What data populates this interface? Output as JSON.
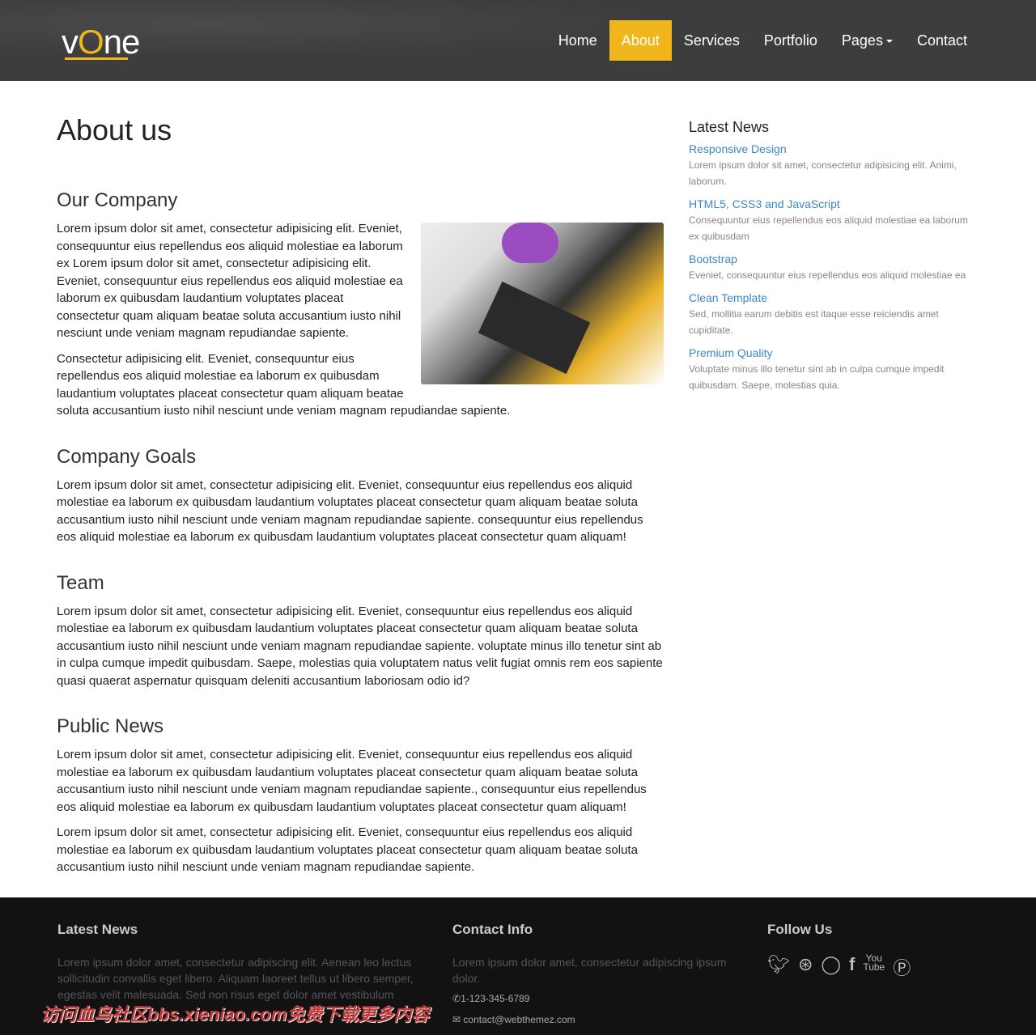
{
  "header": {
    "logo": {
      "v": "v",
      "o": "O",
      "ne": "ne"
    },
    "nav": [
      {
        "label": "Home"
      },
      {
        "label": "About",
        "active": true
      },
      {
        "label": "Services"
      },
      {
        "label": "Portfolio"
      },
      {
        "label": "Pages"
      },
      {
        "label": "Contact"
      }
    ]
  },
  "main": {
    "title": "About us",
    "sections": [
      {
        "heading": "Our Company",
        "paragraphs": [
          "Lorem ipsum dolor sit amet, consectetur adipisicing elit. Eveniet, consequuntur eius repellendus eos aliquid molestiae ea laborum ex Lorem ipsum dolor sit amet, consectetur adipisicing elit. Eveniet, consequuntur eius repellendus eos aliquid molestiae ea laborum ex quibusdam laudantium voluptates placeat consectetur quam aliquam beatae soluta accusantium iusto nihil nesciunt unde veniam magnam repudiandae sapiente.",
          "Consectetur adipisicing elit. Eveniet, consequuntur eius repellendus eos aliquid molestiae ea laborum ex quibusdam laudantium voluptates placeat consectetur quam aliquam beatae soluta accusantium iusto nihil nesciunt unde veniam magnam repudiandae sapiente."
        ]
      },
      {
        "heading": "Company Goals",
        "paragraphs": [
          "Lorem ipsum dolor sit amet, consectetur adipisicing elit. Eveniet, consequuntur eius repellendus eos aliquid molestiae ea laborum ex quibusdam laudantium voluptates placeat consectetur quam aliquam beatae soluta accusantium iusto nihil nesciunt unde veniam magnam repudiandae sapiente. consequuntur eius repellendus eos aliquid molestiae ea laborum ex quibusdam laudantium voluptates placeat consectetur quam aliquam!"
        ]
      },
      {
        "heading": "Team",
        "paragraphs": [
          "Lorem ipsum dolor sit amet, consectetur adipisicing elit. Eveniet, consequuntur eius repellendus eos aliquid molestiae ea laborum ex quibusdam laudantium voluptates placeat consectetur quam aliquam beatae soluta accusantium iusto nihil nesciunt unde veniam magnam repudiandae sapiente. voluptate minus illo tenetur sint ab in culpa cumque impedit quibusdam. Saepe, molestias quia voluptatem natus velit fugiat omnis rem eos sapiente quasi quaerat aspernatur quisquam deleniti accusantium laboriosam odio id?"
        ]
      },
      {
        "heading": "Public News",
        "paragraphs": [
          "Lorem ipsum dolor sit amet, consectetur adipisicing elit. Eveniet, consequuntur eius repellendus eos aliquid molestiae ea laborum ex quibusdam laudantium voluptates placeat consectetur quam aliquam beatae soluta accusantium iusto nihil nesciunt unde veniam magnam repudiandae sapiente., consequuntur eius repellendus eos aliquid molestiae ea laborum ex quibusdam laudantium voluptates placeat consectetur quam aliquam!",
          "Lorem ipsum dolor sit amet, consectetur adipisicing elit. Eveniet, consequuntur eius repellendus eos aliquid molestiae ea laborum ex quibusdam laudantium voluptates placeat consectetur quam aliquam beatae soluta accusantium iusto nihil nesciunt unde veniam magnam repudiandae sapiente."
        ]
      }
    ]
  },
  "sidebar": {
    "title": "Latest News",
    "items": [
      {
        "title": "Responsive Design",
        "text": "Lorem ipsum dolor sit amet, consectetur adipisicing elit. Animi, laborum."
      },
      {
        "title": "HTML5, CSS3 and JavaScript",
        "text": "Consequuntur eius repellendus eos aliquid molestiae ea laborum ex quibusdam"
      },
      {
        "title": "Bootstrap",
        "text": "Eveniet, consequuntur eius repellendus eos aliquid molestiae ea"
      },
      {
        "title": "Clean Template",
        "text": "Sed, mollitia earum debitis est itaque esse reiciendis amet cupiditate."
      },
      {
        "title": "Premium Quality",
        "text": "Voluptate minus illo tenetur sint ab in culpa cumque impedit quibusdam. Saepe, molestias quia."
      }
    ]
  },
  "footer": {
    "news": {
      "title": "Latest News",
      "text": "Lorem ipsum dolor amet, consectetur adipiscing elit. Aenean leo lectus sollicitudin convallis eget libero. Aliquam laoreet tellus ut libero semper, egestas velit malesuada. Sed non risus eget dolor amet vestibulum"
    },
    "contact": {
      "title": "Contact Info",
      "text": "Lorem ipsum dolor amet, consectetur adipiscing ipsum dolor.",
      "phone": "1-123-345-6789",
      "email": "contact@webthemez.com"
    },
    "follow": {
      "title": "Follow Us",
      "icons": [
        "twitter-icon",
        "dribbble-icon",
        "github-icon",
        "facebook-icon",
        "youtube-icon",
        "pinterest-icon"
      ]
    }
  },
  "watermark": "访问血鸟社区bbs.xieniao.com免费下载更多内容",
  "colors": {
    "accent": "#f1b61c",
    "link": "#3a87c8",
    "header_bg": "#3d3d3d",
    "footer_bg": "#121212"
  }
}
